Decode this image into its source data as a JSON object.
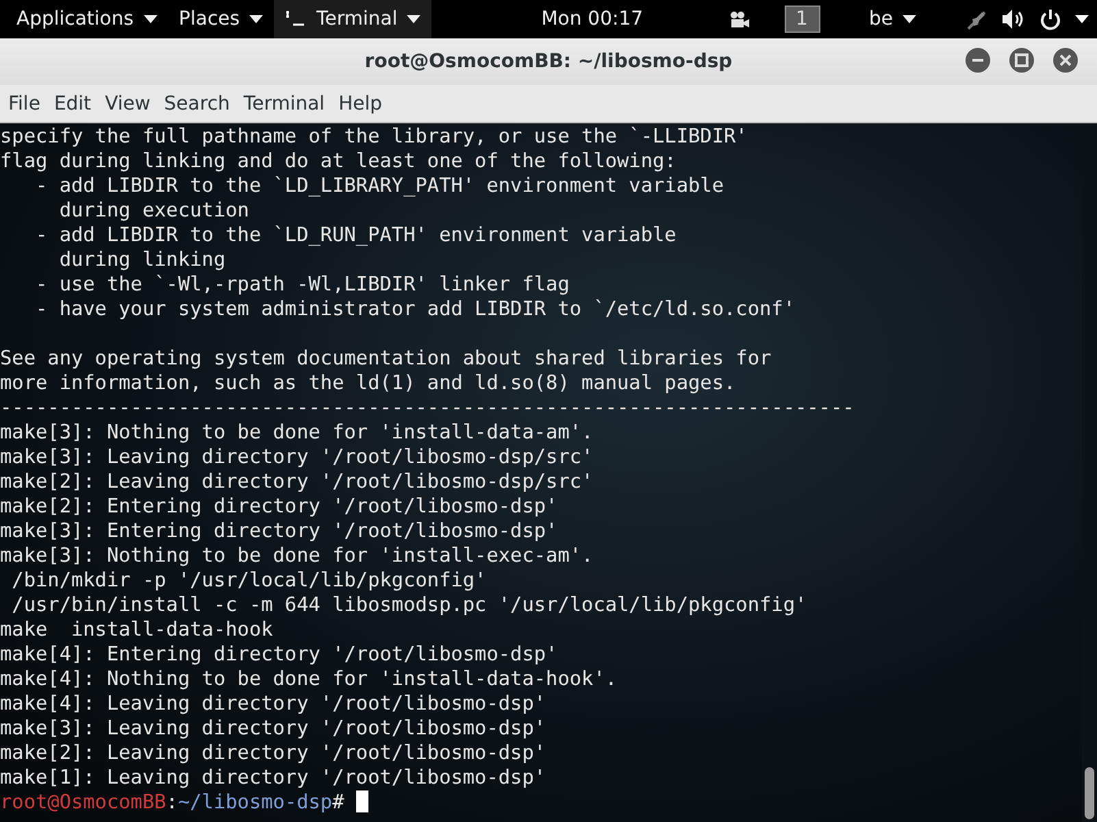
{
  "top_bar": {
    "menus": [
      {
        "label": "Applications",
        "kind": "menu"
      },
      {
        "label": "Places",
        "kind": "menu"
      },
      {
        "label": "Terminal",
        "kind": "app"
      }
    ],
    "clock": "Mon 00:17",
    "workspace": "1",
    "keyboard_layout": "be"
  },
  "window": {
    "title": "root@OsmocomBB: ~/libosmo-dsp"
  },
  "menu_bar": [
    "File",
    "Edit",
    "View",
    "Search",
    "Terminal",
    "Help"
  ],
  "terminal": {
    "blocks": [
      [
        "specify the full pathname of the library, or use the `-LLIBDIR'",
        "flag during linking and do at least one of the following:",
        "   - add LIBDIR to the `LD_LIBRARY_PATH' environment variable",
        "     during execution",
        "   - add LIBDIR to the `LD_RUN_PATH' environment variable",
        "     during linking",
        "   - use the `-Wl,-rpath -Wl,LIBDIR' linker flag",
        "   - have your system administrator add LIBDIR to `/etc/ld.so.conf'"
      ],
      [
        "See any operating system documentation about shared libraries for",
        "more information, such as the ld(1) and ld.so(8) manual pages.",
        "------------------------------------------------------------------------",
        "make[3]: Nothing to be done for 'install-data-am'.",
        "make[3]: Leaving directory '/root/libosmo-dsp/src'",
        "make[2]: Leaving directory '/root/libosmo-dsp/src'",
        "make[2]: Entering directory '/root/libosmo-dsp'",
        "make[3]: Entering directory '/root/libosmo-dsp'",
        "make[3]: Nothing to be done for 'install-exec-am'.",
        " /bin/mkdir -p '/usr/local/lib/pkgconfig'",
        " /usr/bin/install -c -m 644 libosmodsp.pc '/usr/local/lib/pkgconfig'",
        "make  install-data-hook",
        "make[4]: Entering directory '/root/libosmo-dsp'",
        "make[4]: Nothing to be done for 'install-data-hook'.",
        "make[4]: Leaving directory '/root/libosmo-dsp'",
        "make[3]: Leaving directory '/root/libosmo-dsp'",
        "make[2]: Leaving directory '/root/libosmo-dsp'",
        "make[1]: Leaving directory '/root/libosmo-dsp'"
      ]
    ],
    "prompt": {
      "user_host": "root@OsmocomBB",
      "separator": ":",
      "path": "~/libosmo-dsp",
      "symbol": "#"
    }
  }
}
